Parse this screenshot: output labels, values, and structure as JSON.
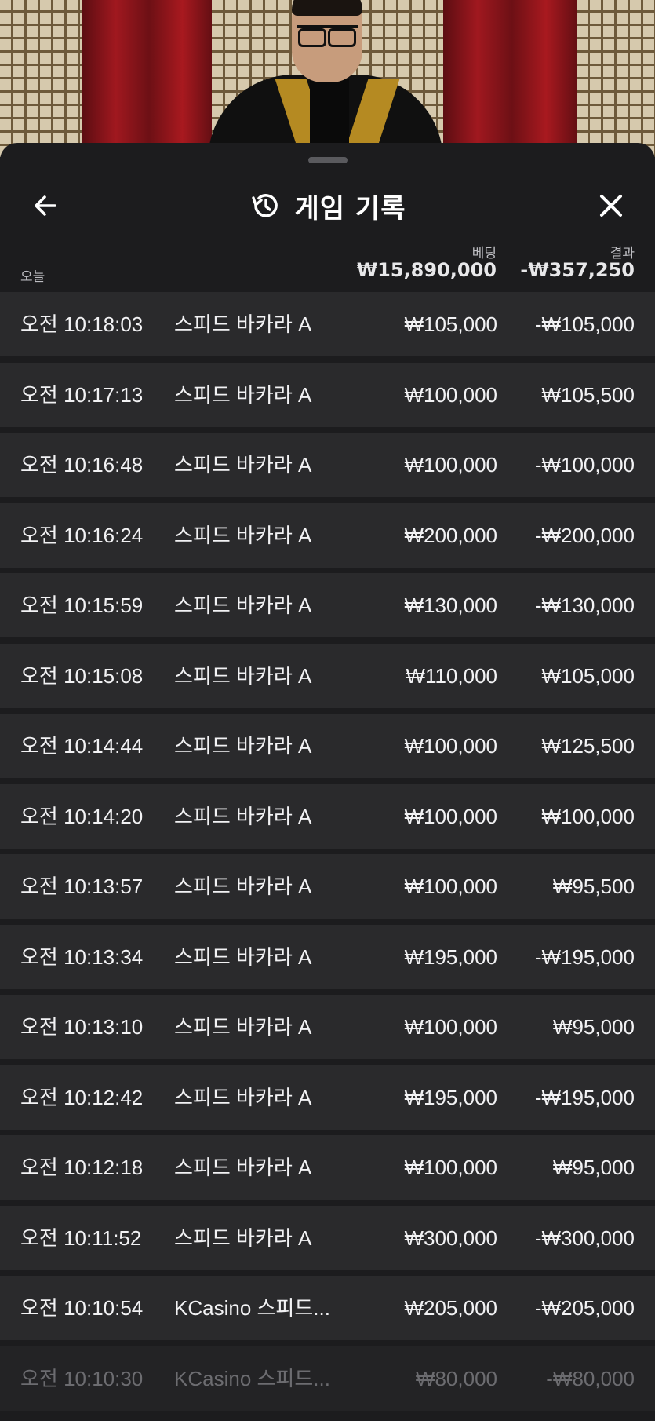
{
  "header": {
    "title": "게임 기록",
    "back_icon": "arrow-left-icon",
    "history_icon": "history-icon",
    "close_icon": "close-icon"
  },
  "summary": {
    "date_label": "오늘",
    "bet_label": "베팅",
    "result_label": "결과",
    "bet_total": "₩15,890,000",
    "result_total": "-₩357,250"
  },
  "rows": [
    {
      "time": "오전 10:18:03",
      "game": "스피드 바카라 A",
      "bet": "₩105,000",
      "result": "-₩105,000"
    },
    {
      "time": "오전 10:17:13",
      "game": "스피드 바카라 A",
      "bet": "₩100,000",
      "result": "₩105,500"
    },
    {
      "time": "오전 10:16:48",
      "game": "스피드 바카라 A",
      "bet": "₩100,000",
      "result": "-₩100,000"
    },
    {
      "time": "오전 10:16:24",
      "game": "스피드 바카라 A",
      "bet": "₩200,000",
      "result": "-₩200,000"
    },
    {
      "time": "오전 10:15:59",
      "game": "스피드 바카라 A",
      "bet": "₩130,000",
      "result": "-₩130,000"
    },
    {
      "time": "오전 10:15:08",
      "game": "스피드 바카라 A",
      "bet": "₩110,000",
      "result": "₩105,000"
    },
    {
      "time": "오전 10:14:44",
      "game": "스피드 바카라 A",
      "bet": "₩100,000",
      "result": "₩125,500"
    },
    {
      "time": "오전 10:14:20",
      "game": "스피드 바카라 A",
      "bet": "₩100,000",
      "result": "₩100,000"
    },
    {
      "time": "오전 10:13:57",
      "game": "스피드 바카라 A",
      "bet": "₩100,000",
      "result": "₩95,500"
    },
    {
      "time": "오전 10:13:34",
      "game": "스피드 바카라 A",
      "bet": "₩195,000",
      "result": "-₩195,000"
    },
    {
      "time": "오전 10:13:10",
      "game": "스피드 바카라 A",
      "bet": "₩100,000",
      "result": "₩95,000"
    },
    {
      "time": "오전 10:12:42",
      "game": "스피드 바카라 A",
      "bet": "₩195,000",
      "result": "-₩195,000"
    },
    {
      "time": "오전 10:12:18",
      "game": "스피드 바카라 A",
      "bet": "₩100,000",
      "result": "₩95,000"
    },
    {
      "time": "오전 10:11:52",
      "game": "스피드 바카라 A",
      "bet": "₩300,000",
      "result": "-₩300,000"
    },
    {
      "time": "오전 10:10:54",
      "game": "KCasino 스피드...",
      "bet": "₩205,000",
      "result": "-₩205,000"
    },
    {
      "time": "오전 10:10:30",
      "game": "KCasino 스피드...",
      "bet": "₩80,000",
      "result": "-₩80,000"
    }
  ]
}
